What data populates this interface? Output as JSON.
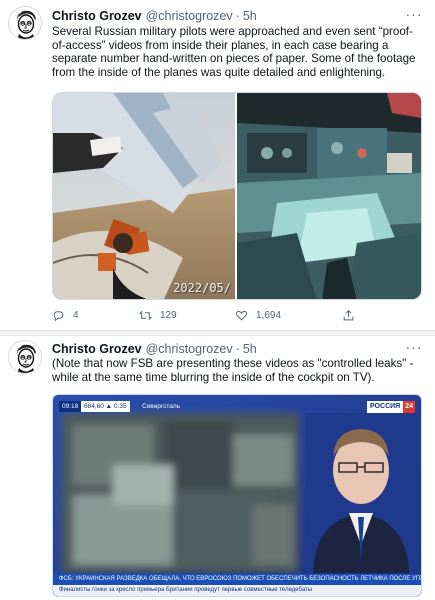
{
  "tweets": [
    {
      "author_name": "Christo Grozev",
      "handle": "@christogrozev",
      "separator": "·",
      "time": "5h",
      "more": "···",
      "text": "Several Russian military pilots were approached and even sent “proof-of-access” videos from inside their planes, in each case bearing a separate number hand-written on pieces of paper. Some of the footage from the inside of the planes was quite detailed and enlightening.",
      "media_timestamp": "2022/05/",
      "actions": {
        "replies": "4",
        "retweets": "129",
        "likes": "1,694"
      }
    },
    {
      "author_name": "Christo Grozev",
      "handle": "@christogrozev",
      "separator": "·",
      "time": "5h",
      "more": "···",
      "text": "(Note that now FSB are presenting these videos as \"controlled leaks\"  - while at the same time blurring the inside of the cockpit on TV).",
      "tv": {
        "clock": "09:18",
        "stock": "684,60 ▲ 0.35",
        "place": "Севергсталь",
        "channel": "РОССИЯ",
        "channel_num": "24",
        "ticker_top": "ФСБ: УКРАИНСКАЯ РАЗВЕДКА ОБЕЩАЛА, ЧТО ЕВРОСОЮЗ ПОМОЖЕТ ОБЕСПЕЧИТЬ БЕЗОПАСНОСТЬ ЛЕТЧИКА ПОСЛЕ УГОНА",
        "ticker_bottom": "Финалисты гонки за кресло премьера Британии проведут первые совместные теледебаты"
      }
    }
  ],
  "colors": {
    "text": "#0f1419",
    "secondary": "#536471",
    "border": "#cfd9de",
    "separator": "#f2f2f2",
    "tv_blue": "#0d2f82",
    "tv_red": "#e23b2e"
  },
  "icons": [
    "reply-icon",
    "retweet-icon",
    "like-icon",
    "share-icon",
    "more-icon"
  ]
}
